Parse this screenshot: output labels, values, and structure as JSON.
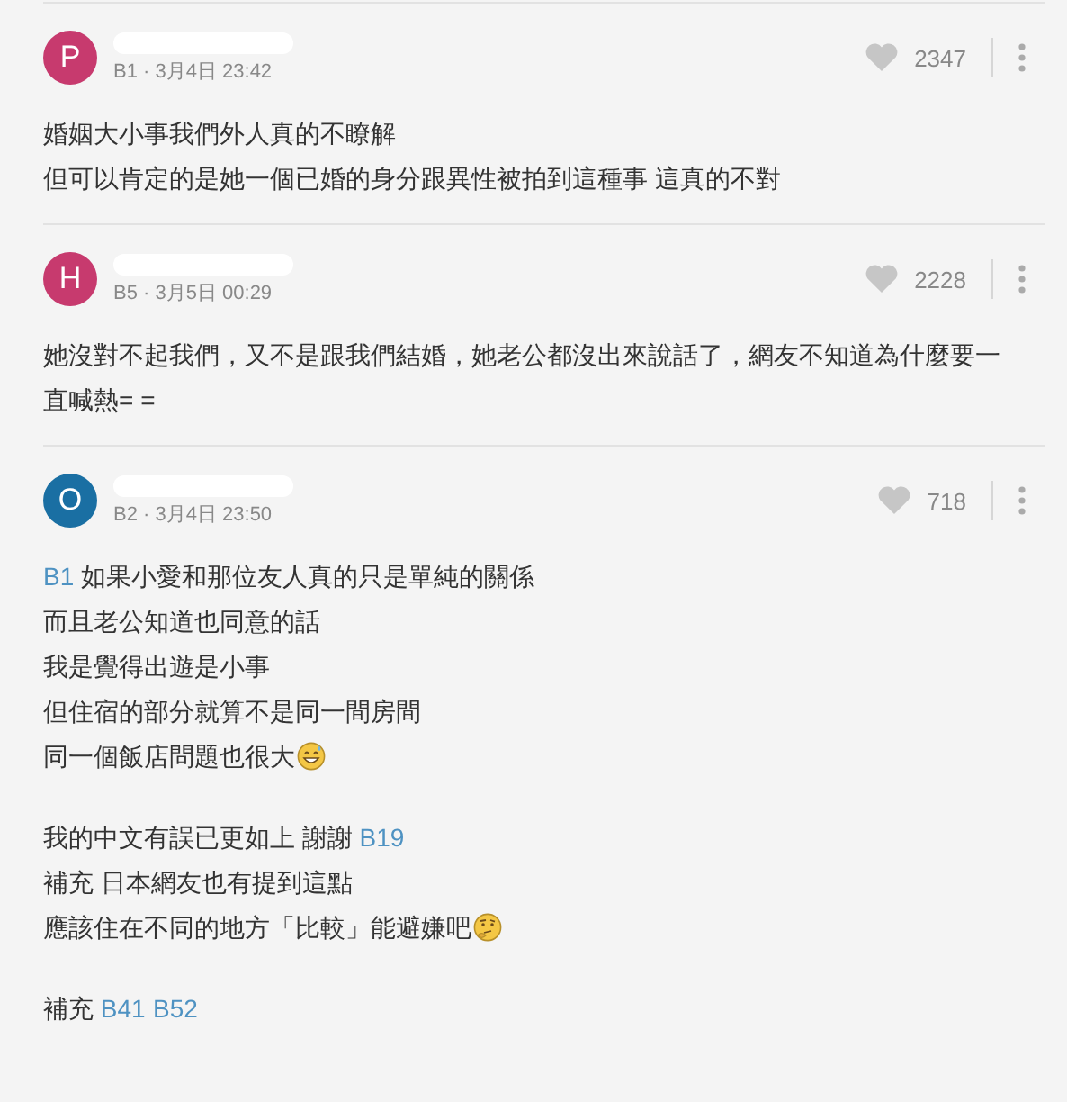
{
  "comments": [
    {
      "avatar": {
        "letter": "P",
        "color": "#c73a6e"
      },
      "meta": "B1 · 3月4日 23:42",
      "likes": "2347",
      "lines": [
        {
          "kind": "text",
          "segments": [
            {
              "kind": "text",
              "text": "婚姻大小事我們外人真的不瞭解"
            }
          ]
        },
        {
          "kind": "text",
          "segments": [
            {
              "kind": "text",
              "text": "但可以肯定的是她一個已婚的身分跟異性被拍到這種事 這真的不對"
            }
          ]
        }
      ]
    },
    {
      "avatar": {
        "letter": "H",
        "color": "#c73a6e"
      },
      "meta": "B5 · 3月5日 00:29",
      "likes": "2228",
      "lines": [
        {
          "kind": "text",
          "segments": [
            {
              "kind": "text",
              "text": "她沒對不起我們，又不是跟我們結婚，她老公都沒出來說話了，網友不知道為什麼要一直喊熱= ="
            }
          ]
        }
      ]
    },
    {
      "avatar": {
        "letter": "O",
        "color": "#1a6fa3"
      },
      "meta": "B2 · 3月4日 23:50",
      "likes": "718",
      "lines": [
        {
          "kind": "text",
          "segments": [
            {
              "kind": "mention",
              "text": "B1"
            },
            {
              "kind": "text",
              "text": " 如果小愛和那位友人真的只是單純的關係"
            }
          ]
        },
        {
          "kind": "text",
          "segments": [
            {
              "kind": "text",
              "text": "而且老公知道也同意的話"
            }
          ]
        },
        {
          "kind": "text",
          "segments": [
            {
              "kind": "text",
              "text": "我是覺得出遊是小事"
            }
          ]
        },
        {
          "kind": "text",
          "segments": [
            {
              "kind": "text",
              "text": "但住宿的部分就算不是同一間房間"
            }
          ]
        },
        {
          "kind": "text",
          "segments": [
            {
              "kind": "text",
              "text": "同一個飯店問題也很大"
            },
            {
              "kind": "sweat-emoji"
            }
          ]
        },
        {
          "kind": "blank"
        },
        {
          "kind": "text",
          "segments": [
            {
              "kind": "text",
              "text": "我的中文有誤已更如上 謝謝 "
            },
            {
              "kind": "mention",
              "text": "B19"
            }
          ]
        },
        {
          "kind": "text",
          "segments": [
            {
              "kind": "text",
              "text": "補充 日本網友也有提到這點"
            }
          ]
        },
        {
          "kind": "text",
          "segments": [
            {
              "kind": "text",
              "text": "應該住在不同的地方「比較」能避嫌吧"
            },
            {
              "kind": "thinking-emoji"
            }
          ]
        },
        {
          "kind": "blank"
        },
        {
          "kind": "text",
          "segments": [
            {
              "kind": "text",
              "text": "補充 "
            },
            {
              "kind": "mention",
              "text": "B41"
            },
            {
              "kind": "mention",
              "text": "B52"
            }
          ]
        }
      ]
    }
  ]
}
